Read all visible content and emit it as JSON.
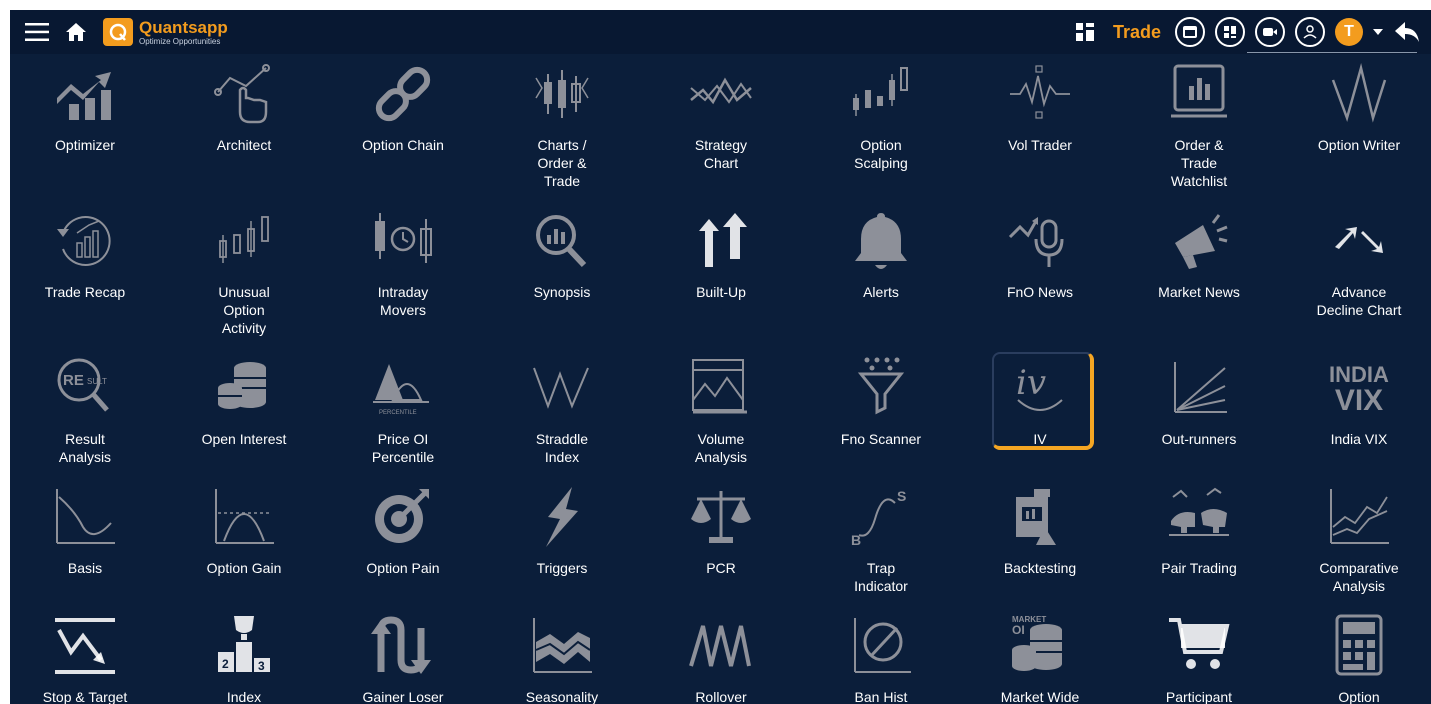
{
  "header": {
    "brand": "Quantsapp",
    "tagline": "Optimize Opportunities",
    "trade_label": "Trade",
    "avatar_letter": "T"
  },
  "tools": [
    {
      "label": "Optimizer",
      "icon": "optimizer-icon"
    },
    {
      "label": "Architect",
      "icon": "architect-icon"
    },
    {
      "label": "Option Chain",
      "icon": "chain-link-icon"
    },
    {
      "label": "Charts / Order & Trade",
      "icon": "candlestick-icon"
    },
    {
      "label": "Strategy Chart",
      "icon": "strategy-chart-icon"
    },
    {
      "label": "Option Scalping",
      "icon": "scalping-icon"
    },
    {
      "label": "Vol Trader",
      "icon": "vol-trader-icon"
    },
    {
      "label": "Order & Trade Watchlist",
      "icon": "watchlist-icon"
    },
    {
      "label": "Option Writer",
      "icon": "option-writer-icon"
    },
    {
      "label": "Trade Recap",
      "icon": "trade-recap-icon"
    },
    {
      "label": "Unusual Option Activity",
      "icon": "unusual-activity-icon"
    },
    {
      "label": "Intraday Movers",
      "icon": "intraday-movers-icon"
    },
    {
      "label": "Synopsis",
      "icon": "synopsis-icon"
    },
    {
      "label": "Built-Up",
      "icon": "built-up-icon"
    },
    {
      "label": "Alerts",
      "icon": "bell-icon"
    },
    {
      "label": "FnO News",
      "icon": "fno-news-icon"
    },
    {
      "label": "Market News",
      "icon": "megaphone-icon"
    },
    {
      "label": "Advance Decline Chart",
      "icon": "advance-decline-icon"
    },
    {
      "label": "Result Analysis",
      "icon": "result-analysis-icon",
      "icon_text": "RESULT"
    },
    {
      "label": "Open Interest",
      "icon": "coins-stack-icon"
    },
    {
      "label": "Price OI Percentile",
      "icon": "percentile-icon",
      "icon_text": "PERCENTILE"
    },
    {
      "label": "Straddle Index",
      "icon": "straddle-icon"
    },
    {
      "label": "Volume Analysis",
      "icon": "volume-analysis-icon"
    },
    {
      "label": "Fno Scanner",
      "icon": "funnel-icon"
    },
    {
      "label": "IV",
      "icon": "iv-icon",
      "icon_text": "iv"
    },
    {
      "label": "Out-runners",
      "icon": "out-runners-icon"
    },
    {
      "label": "India VIX",
      "icon": "india-vix-icon",
      "icon_text": "INDIA VIX"
    },
    {
      "label": "Basis",
      "icon": "basis-icon"
    },
    {
      "label": "Option Gain",
      "icon": "option-gain-icon"
    },
    {
      "label": "Option Pain",
      "icon": "target-icon"
    },
    {
      "label": "Triggers",
      "icon": "lightning-icon"
    },
    {
      "label": "PCR",
      "icon": "scales-icon"
    },
    {
      "label": "Trap Indicator",
      "icon": "trap-icon"
    },
    {
      "label": "Backtesting",
      "icon": "backtesting-icon"
    },
    {
      "label": "Pair Trading",
      "icon": "bull-bear-icon"
    },
    {
      "label": "Comparative Analysis",
      "icon": "comparative-icon"
    },
    {
      "label": "Stop & Target",
      "icon": "stop-target-icon"
    },
    {
      "label": "Index Contributors",
      "icon": "trophy-podium-icon"
    },
    {
      "label": "Gainer Loser",
      "icon": "gainer-loser-icon"
    },
    {
      "label": "Seasonality",
      "icon": "seasonality-icon"
    },
    {
      "label": "Rollover",
      "icon": "rollover-icon"
    },
    {
      "label": "Ban Hist",
      "icon": "ban-icon"
    },
    {
      "label": "Market Wide OI",
      "icon": "market-wide-oi-icon",
      "icon_text": "MARKET OI"
    },
    {
      "label": "Participant Data",
      "icon": "cart-icon"
    },
    {
      "label": "Option Calculator",
      "icon": "calculator-icon"
    }
  ],
  "selected_tool": "IV"
}
